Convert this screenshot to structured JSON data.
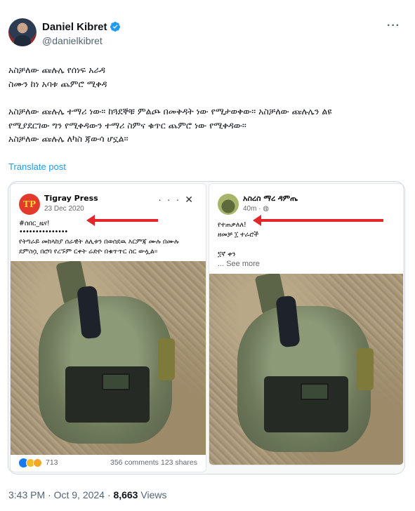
{
  "author": {
    "name": "Daniel Kibret",
    "handle": "@danielkibret",
    "verified": true,
    "more_icon": "more-horizontal-icon"
  },
  "tweet": {
    "lines": [
      "አስቻለው ጩሉሌ የሰነፍ አራዳ",
      "ስሙን ከነ አባቱ ጨምሮ ሚቀዳ",
      "",
      "አስቻለው ጩሉሌ ተማሪ ነው፡፡ ከጓደኞቹ ምልጮ በመቅዳት ነው የሚታወቀው፡፡ አስቻለው ጩሉሌን ልዩ",
      "የሚያደርገው ግን የሚቀዳውን ተማሪ ስምና ቁጥር ጨምሮ ነው የሚቀዳው፡፡",
      "አስቻለው ጩሉሌ ለካስ ጃውሳ ሆኗል።"
    ],
    "translate_label": "Translate post"
  },
  "left_post": {
    "page_name": "Tigray Press",
    "logo_text": "TP",
    "date": "23 Dec 2020",
    "icons": [
      "more-horizontal-icon",
      "close-icon"
    ],
    "hashtag": "#ሰበር_ዜና!",
    "dots": "•••••••••••••••",
    "body_line1": "የትግራይ መከላከያ ሰራዊት ለሊቱን በወሰደዉ እርምጃ ሙሉ በሙሉ",
    "body_line2": "ደምስሷ በሮባ የረኙም ርቀት ሬድዮ በቁጥጥር ስር ውሏል።",
    "reaction_count": "713",
    "comments": "356 comments",
    "shares": "123 shares"
  },
  "right_post": {
    "page_name": "አስረስ ማረ ዳምጤ",
    "time": "40m",
    "body_line1": "የተጠቃለለ!",
    "body_line2": "ዘመቻ ፲ ተራሮች",
    "body_line3": "፺ኛ ቀን",
    "see_more": "... See more"
  },
  "footer": {
    "time": "3:43 PM",
    "separator1": " · ",
    "date": "Oct 9, 2024",
    "separator2": " · ",
    "views_count": "8,663",
    "views_label": " Views"
  },
  "colors": {
    "accent": "#1d9bf0",
    "arrow": "#e4262a",
    "muted": "#536471"
  }
}
